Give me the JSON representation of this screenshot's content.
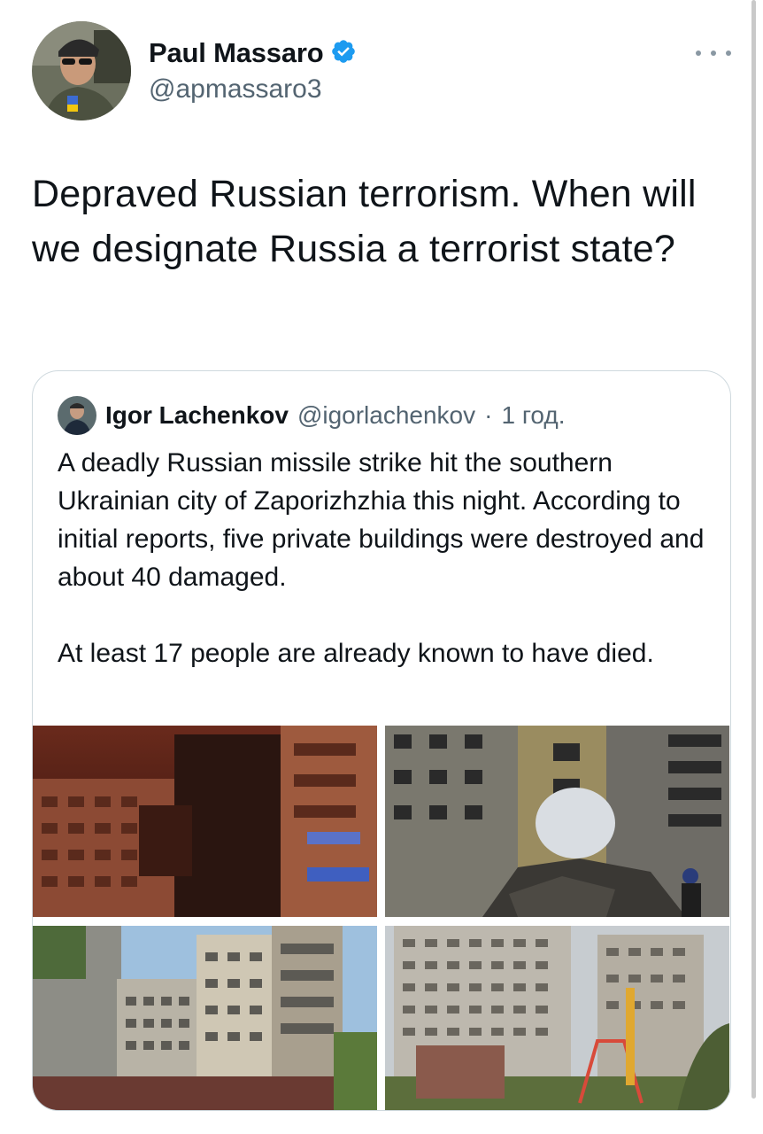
{
  "tweet": {
    "author": {
      "name": "Paul Massaro",
      "handle": "@apmassaro3",
      "verified": true
    },
    "text": "Depraved Russian terrorism. When will we designate Russia a terrorist state?",
    "more_icon": "ellipsis-icon"
  },
  "quoted_tweet": {
    "author": {
      "name": "Igor Lachenkov",
      "handle": "@igorlachenkov"
    },
    "separator": "·",
    "time": "1 год.",
    "text": "A deadly Russian missile strike hit the southern Ukrainian city of Zaporizhzhia this night. According to initial reports, five private buildings were destroyed and about 40 damaged.\n\nAt least 17 people are already known to have died.",
    "media_count": 4
  },
  "colors": {
    "text": "#0f1419",
    "secondary": "#536471",
    "verified": "#1d9bf0",
    "border": "#cfd9de"
  }
}
